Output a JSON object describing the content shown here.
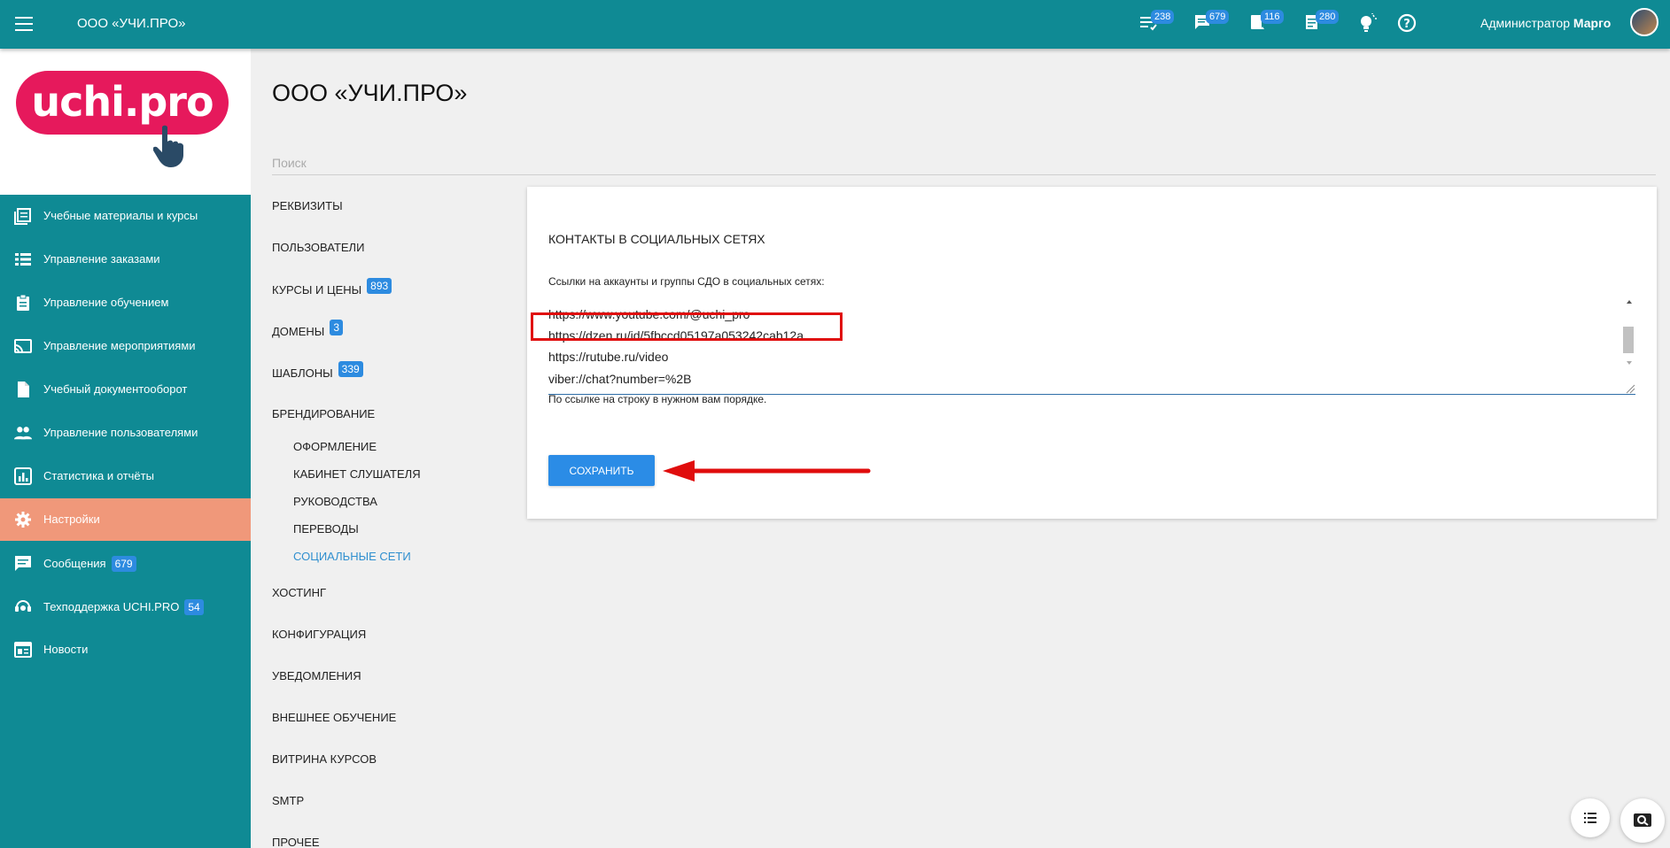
{
  "header": {
    "org_name": "ООО «УЧИ.ПРО»",
    "icons": [
      {
        "name": "tasks-icon",
        "badge": "238"
      },
      {
        "name": "messages-icon",
        "badge": "679"
      },
      {
        "name": "orders-icon",
        "badge": "116"
      },
      {
        "name": "documents-icon",
        "badge": "280"
      },
      {
        "name": "ideas-icon"
      },
      {
        "name": "help-icon"
      }
    ],
    "user_role": "Администратор",
    "user_name": "Марго"
  },
  "logo": {
    "text": "uchi.pro"
  },
  "sidebar": {
    "items": [
      {
        "label": "Учебные материалы и курсы",
        "icon": "book-icon"
      },
      {
        "label": "Управление заказами",
        "icon": "list-icon"
      },
      {
        "label": "Управление обучением",
        "icon": "clipboard-icon"
      },
      {
        "label": "Управление мероприятиями",
        "icon": "cast-icon"
      },
      {
        "label": "Учебный документооборот",
        "icon": "document-icon"
      },
      {
        "label": "Управление пользователями",
        "icon": "users-icon"
      },
      {
        "label": "Статистика и отчёты",
        "icon": "chart-icon"
      },
      {
        "label": "Настройки",
        "icon": "gear-icon",
        "active": true
      },
      {
        "label": "Сообщения",
        "icon": "chat-icon",
        "badge": "679"
      },
      {
        "label": "Техподдержка UCHI.PRO",
        "icon": "support-icon",
        "badge": "54"
      },
      {
        "label": "Новости",
        "icon": "news-icon"
      }
    ]
  },
  "main": {
    "title": "ООО «УЧИ.ПРО»",
    "search_placeholder": "Поиск",
    "subnav": [
      {
        "label": "РЕКВИЗИТЫ"
      },
      {
        "label": "ПОЛЬЗОВАТЕЛИ"
      },
      {
        "label": "КУРСЫ И ЦЕНЫ",
        "badge": "893"
      },
      {
        "label": "ДОМЕНЫ",
        "badge": "3"
      },
      {
        "label": "ШАБЛОНЫ",
        "badge": "339"
      },
      {
        "label": "БРЕНДИРОВАНИЕ"
      },
      {
        "label": "ОФОРМЛЕНИЕ"
      },
      {
        "label": "КАБИНЕТ СЛУШАТЕЛЯ"
      },
      {
        "label": "РУКОВОДСТВА"
      },
      {
        "label": "ПЕРЕВОДЫ"
      },
      {
        "label": "СОЦИАЛЬНЫЕ СЕТИ"
      },
      {
        "label": "ХОСТИНГ"
      },
      {
        "label": "КОНФИГУРАЦИЯ"
      },
      {
        "label": "УВЕДОМЛЕНИЯ"
      },
      {
        "label": "ВНЕШНЕЕ ОБУЧЕНИЕ"
      },
      {
        "label": "ВИТРИНА КУРСОВ"
      },
      {
        "label": "SMTP"
      },
      {
        "label": "ПРОЧЕЕ"
      }
    ],
    "card": {
      "title": "КОНТАКТЫ В СОЦИАЛЬНЫХ СЕТЯХ",
      "field_label": "Ссылки на аккаунты и группы СДО в социальных сетях:",
      "links": [
        "https://www.youtube.com/@uchi_pro",
        "https://dzen.ru/id/5fbccd05197a053242cab12a",
        "https://rutube.ru/video",
        "viber://chat?number=%2B"
      ],
      "hint": "По ссылке на строку в нужном вам порядке.",
      "save_label": "СОХРАНИТЬ"
    }
  },
  "colors": {
    "teal": "#0f8a94",
    "active": "#f0987a",
    "accent": "#2b8ce6",
    "highlight": "#e00d0d",
    "logo": "#e6195c"
  }
}
